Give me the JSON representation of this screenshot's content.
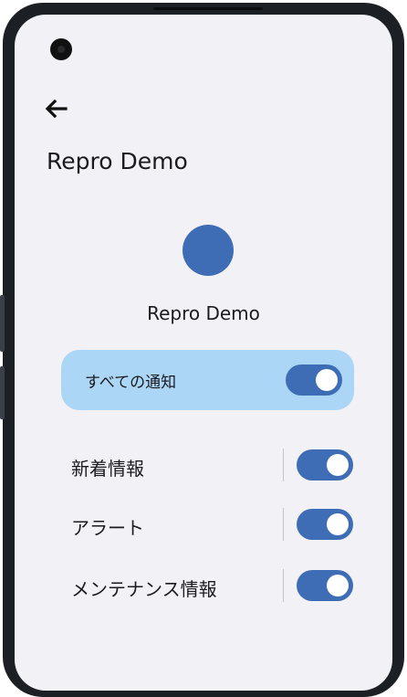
{
  "app": {
    "title": "Repro Demo",
    "back_icon": "arrow-back-icon"
  },
  "profile": {
    "name": "Repro Demo",
    "avatar_color": "#3e6db5"
  },
  "all_notifications": {
    "label": "すべての通知",
    "enabled": true,
    "card_color": "#abd6f5"
  },
  "channels": [
    {
      "label": "新着情報",
      "enabled": true
    },
    {
      "label": "アラート",
      "enabled": true
    },
    {
      "label": "メンテナンス情報",
      "enabled": true
    }
  ],
  "colors": {
    "accent": "#3e6db5",
    "background": "#f2f1f6"
  }
}
